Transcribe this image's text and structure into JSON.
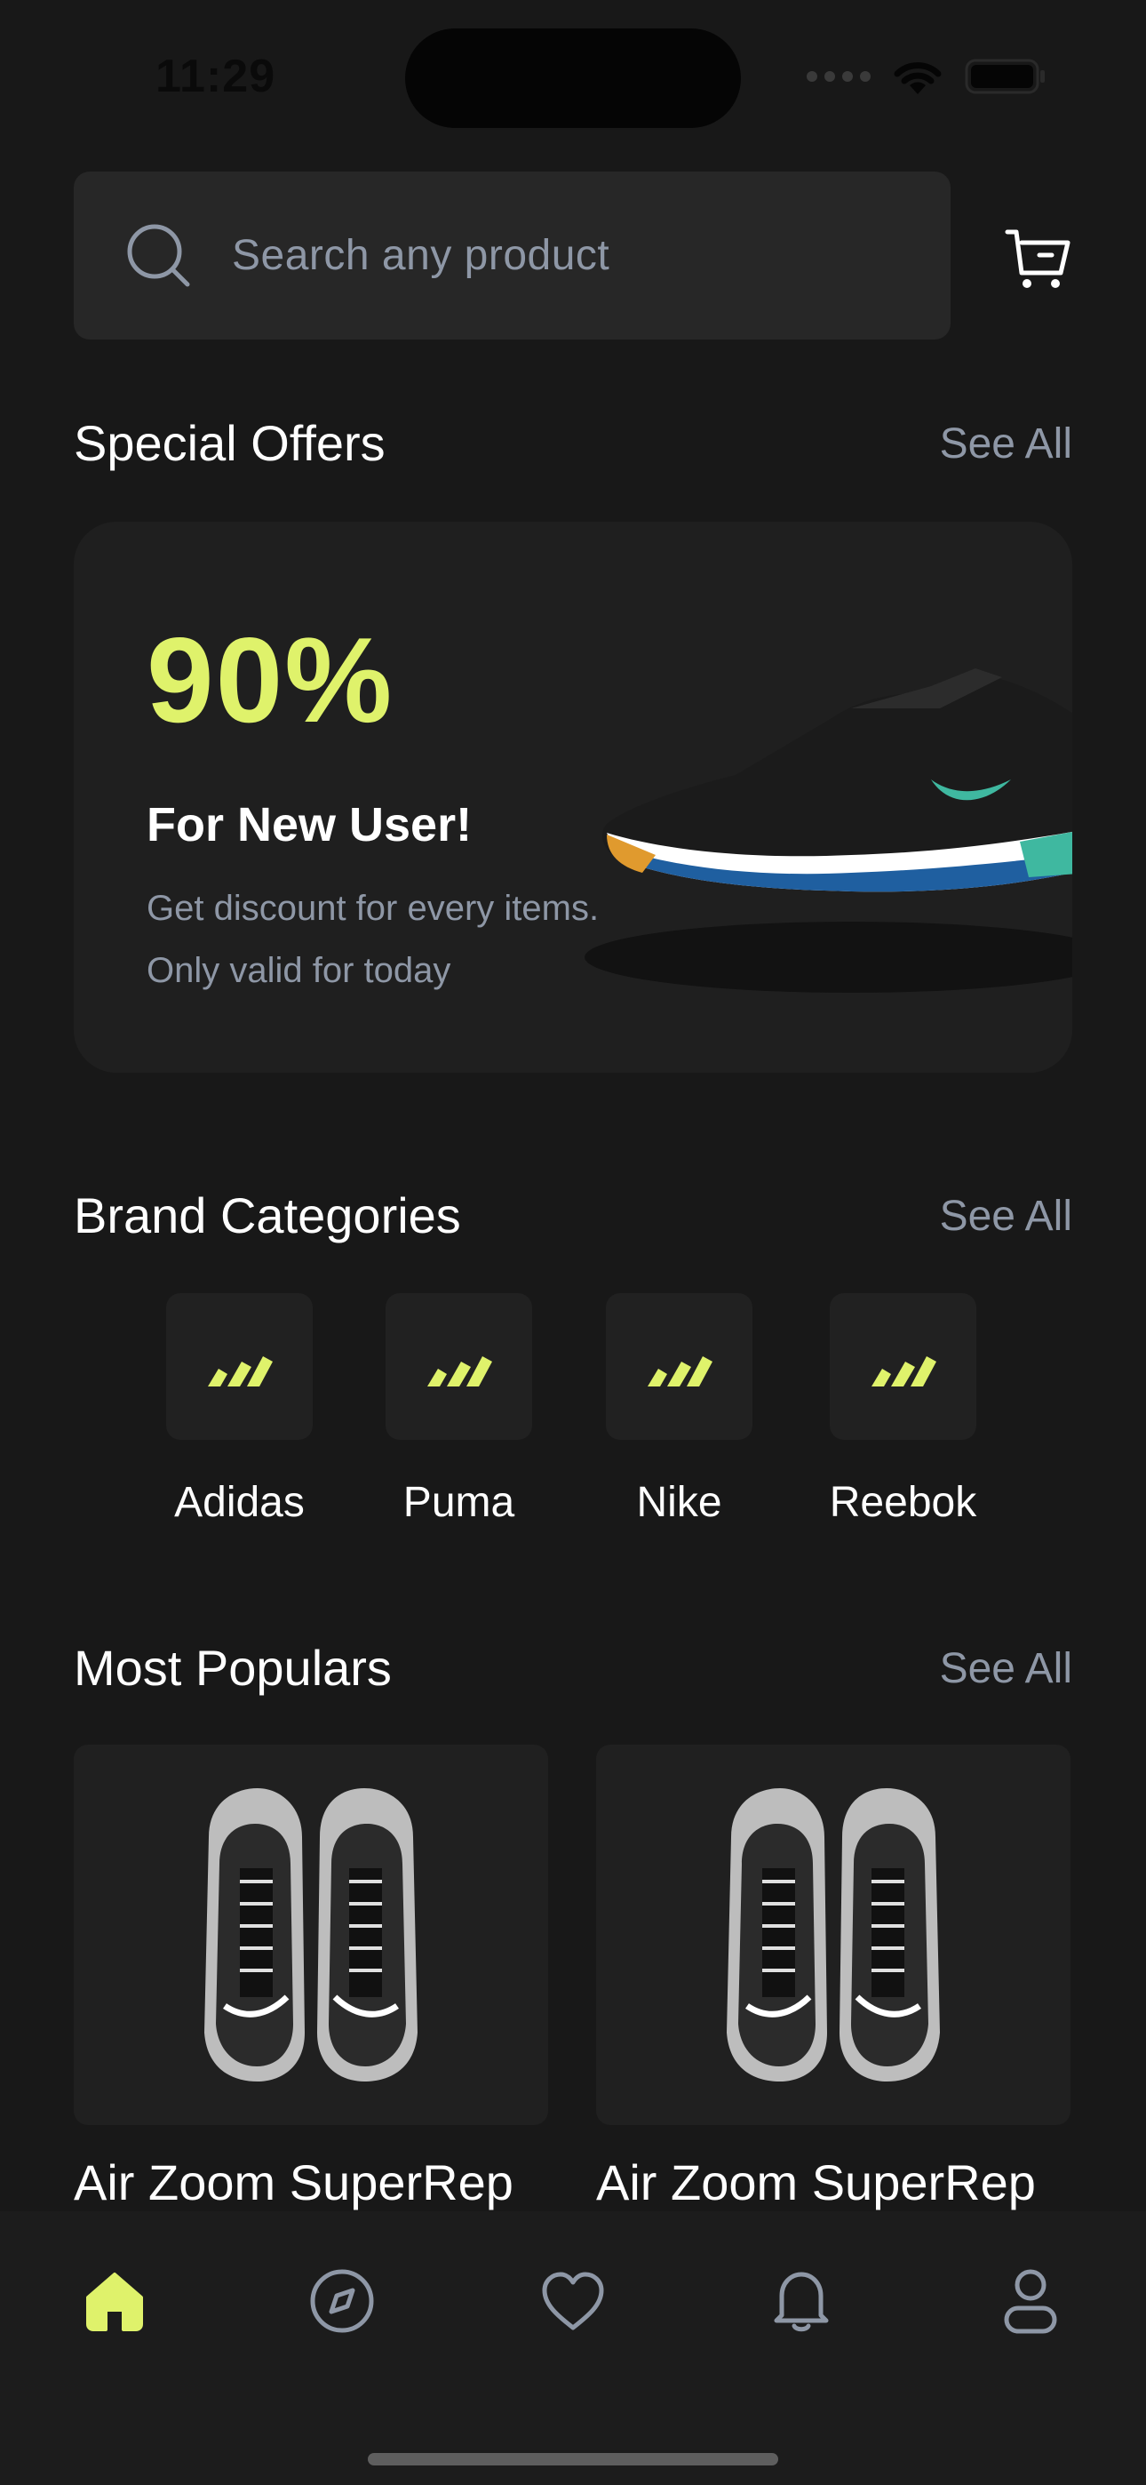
{
  "status_bar": {
    "time": "11:29"
  },
  "search": {
    "placeholder": "Search any product"
  },
  "icons": {
    "search": "search-icon",
    "cart": "cart-icon",
    "brand_logo": "adidas-logo-icon",
    "nav": [
      "home-icon",
      "compass-icon",
      "heart-icon",
      "bell-icon",
      "profile-icon"
    ]
  },
  "colors": {
    "accent": "#dff26b",
    "background": "#181818",
    "card": "#1f1f1f",
    "muted": "#8e97a6"
  },
  "special_offers": {
    "title": "Special Offers",
    "see_all": "See All",
    "discount": "90%",
    "headline": "For New User!",
    "description": "Get discount for every items. Only valid for today"
  },
  "brand_categories": {
    "title": "Brand Categories",
    "see_all": "See All",
    "brands": [
      {
        "label": "Adidas"
      },
      {
        "label": "Puma"
      },
      {
        "label": "Nike"
      },
      {
        "label": "Reebok"
      }
    ]
  },
  "most_populars": {
    "title": "Most Populars",
    "see_all": "See All",
    "products": [
      {
        "name": "Air Zoom SuperRep"
      },
      {
        "name": "Air Zoom SuperRep"
      }
    ]
  },
  "bottom_nav": {
    "active": "home"
  }
}
